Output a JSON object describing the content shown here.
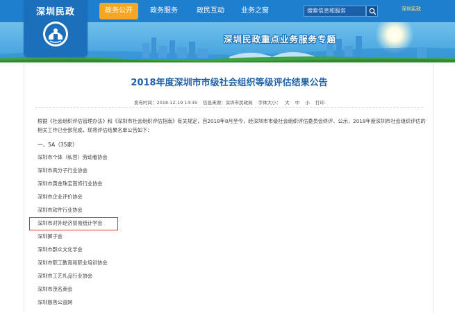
{
  "header": {
    "logo_title": "深圳民政",
    "nav": [
      "政务公开",
      "政务服务",
      "政民互动",
      "业务之窗"
    ],
    "active_index": 0,
    "search_placeholder": "搜索信息和服务",
    "badge_text": "深圳民政",
    "banner_slogan": "深圳民政重点业务服务专题"
  },
  "article": {
    "title": "2018年度深圳市市级社会组织等级评估结果公告",
    "meta": {
      "time": "发布时间：2018-12-19 14:35",
      "source": "信息来源：深圳市民政局",
      "font_label": "字体大小：",
      "size_large": "大",
      "size_medium": "中",
      "size_small": "小",
      "print": "打印"
    },
    "intro": "根据《社会组织评估管理办法》和《深圳市社会组织评估指南》有关规定，自2018年8月至今，经深圳市市级社会组织评估委员会终评、公示，2018年度深圳市社会组织评估的相关工作已全部完成，现将评估结果名单公告如下：",
    "section_heading": "一、5A（35家）",
    "organizations": [
      "深圳市个体（私营）劳动者协会",
      "深圳市高分子行业协会",
      "深圳市黄金珠宝首饰行业协会",
      "深圳市企业评价协会",
      "深圳市软件行业协会",
      "深圳市对外经济贸易统计学会",
      "深圳狮子会",
      "深圳市群众文化学会",
      "深圳市职工教育和职业培训协会",
      "深圳市工艺礼品行业协会",
      "深圳市茂名商会",
      "深圳慈善公益网"
    ],
    "highlighted_index": 5
  },
  "colors": {
    "nav_bar": "#1f7fcf",
    "nav_active": "#f5a623",
    "title_blue": "#1f5fa8",
    "highlight_red": "#e0302a"
  }
}
